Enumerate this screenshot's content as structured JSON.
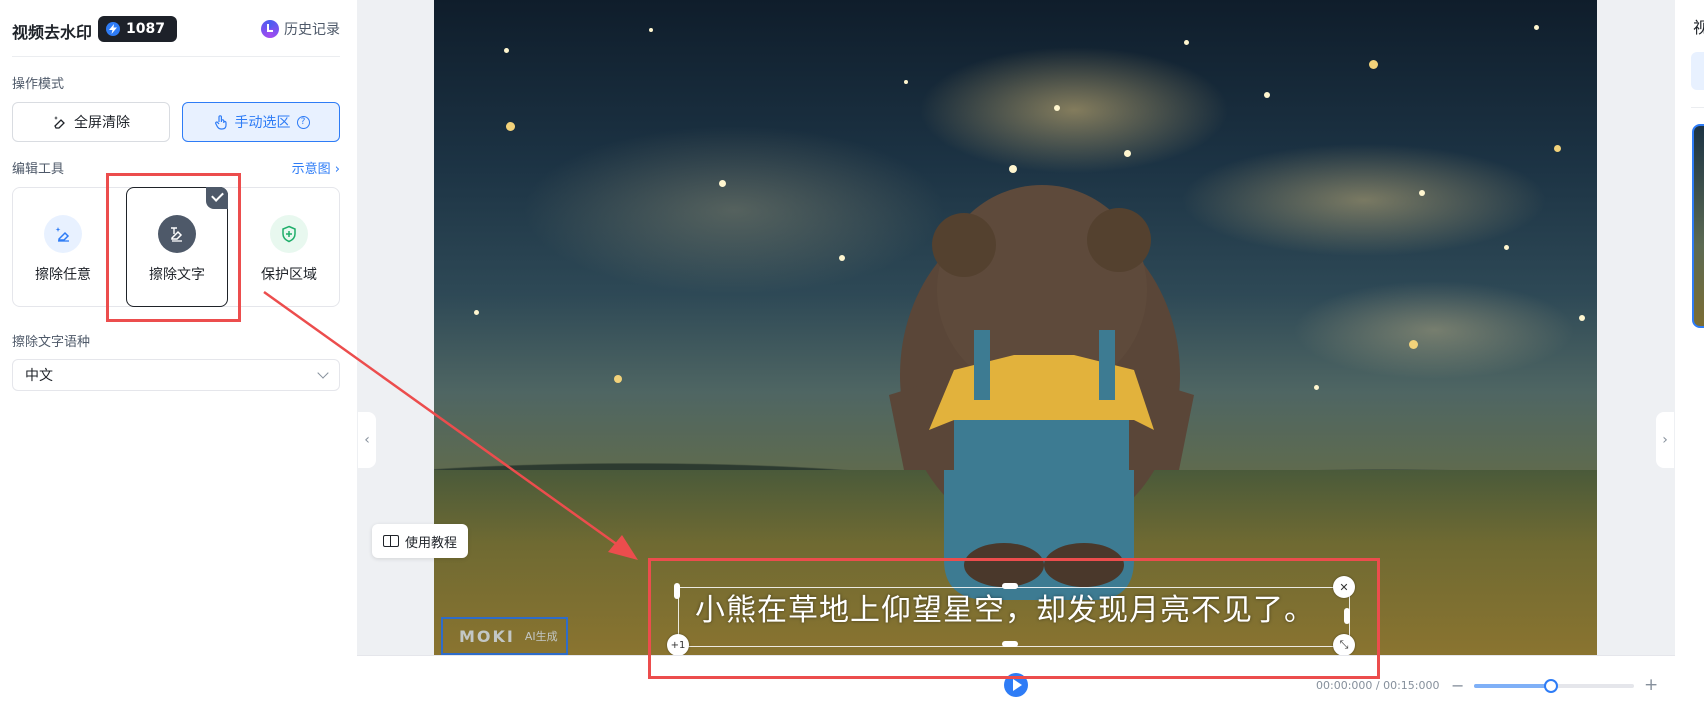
{
  "header": {
    "app_title": "视频去水印",
    "credits": "1087",
    "history_label": "历史记录"
  },
  "mode": {
    "section_label": "操作模式",
    "fullscreen_label": "全屏清除",
    "manual_label": "手动选区",
    "active": "manual"
  },
  "tools": {
    "section_label": "编辑工具",
    "demo_link": "示意图",
    "items": [
      {
        "label": "擦除任意",
        "icon": "eraser-sparkle-icon"
      },
      {
        "label": "擦除文字",
        "icon": "text-eraser-icon",
        "selected": true
      },
      {
        "label": "保护区域",
        "icon": "shield-plus-icon"
      }
    ]
  },
  "language": {
    "section_label": "擦除文字语种",
    "value": "中文"
  },
  "video": {
    "subtitle": "小熊在草地上仰望星空，却发现月亮不见了。",
    "add_handle": "+1",
    "watermark_logo": "MOKI",
    "watermark_tag": "AI生成"
  },
  "tutorial_label": "使用教程",
  "timeline": {
    "time": "00:00:000 / 00:15:000",
    "zoom_level": 0.48
  },
  "right_panel": {
    "title": "视"
  },
  "colors": {
    "accent": "#2e7cf6",
    "annotation": "#ec4d4d",
    "badge_bg": "#1d2129"
  }
}
